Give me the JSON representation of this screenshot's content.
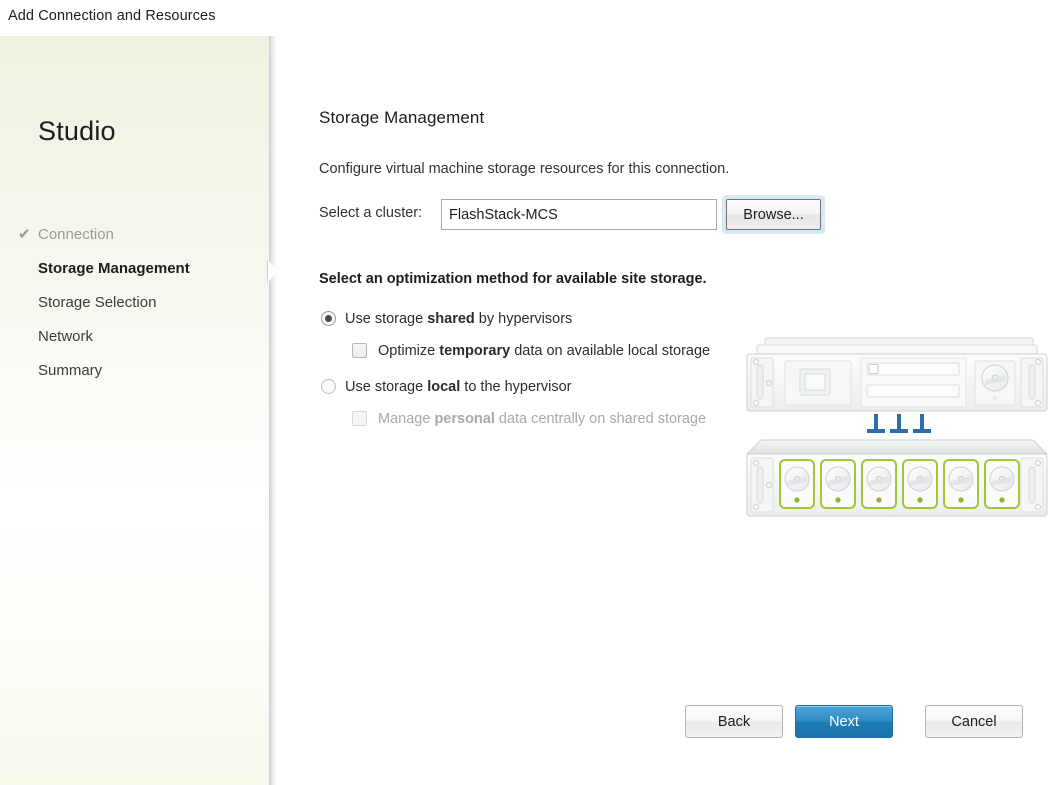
{
  "window": {
    "title": "Add Connection and Resources"
  },
  "sidebar": {
    "brand": "Studio",
    "steps": [
      {
        "label": "Connection",
        "state": "done",
        "icon": "check-icon"
      },
      {
        "label": "Storage Management",
        "state": "current"
      },
      {
        "label": "Storage Selection",
        "state": "upcoming"
      },
      {
        "label": "Network",
        "state": "upcoming"
      },
      {
        "label": "Summary",
        "state": "upcoming"
      }
    ]
  },
  "content": {
    "title": "Storage Management",
    "description": "Configure virtual machine storage resources for this connection.",
    "cluster": {
      "label": "Select a cluster:",
      "value": "FlashStack-MCS",
      "placeholder": "",
      "browse_label": "Browse..."
    },
    "options_title": "Select an optimization method for available site storage.",
    "options": [
      {
        "id": "shared",
        "selected": true,
        "text_parts": [
          "Use storage ",
          "shared",
          " by hypervisors"
        ],
        "sub": {
          "checked": false,
          "disabled": false,
          "text_parts": [
            "Optimize ",
            "temporary",
            " data on available local storage"
          ]
        }
      },
      {
        "id": "local",
        "selected": false,
        "text_parts": [
          "Use storage ",
          "local",
          " to the hypervisor"
        ],
        "sub": {
          "checked": false,
          "disabled": true,
          "text_parts": [
            "Manage ",
            "personal",
            " data centrally on shared storage"
          ]
        }
      }
    ],
    "illustration": {
      "name": "shared-storage-diagram",
      "server_bays": 2,
      "connector_count": 3,
      "disk_count": 6,
      "disk_accent": "#a3c639",
      "connector_color": "#2c6fa8"
    }
  },
  "footer": {
    "back_label": "Back",
    "next_label": "Next",
    "cancel_label": "Cancel"
  },
  "colors": {
    "panel_green": "#eef2e0",
    "primary_blue": "#2f8cc4",
    "focus_glow": "#78b9e1"
  }
}
